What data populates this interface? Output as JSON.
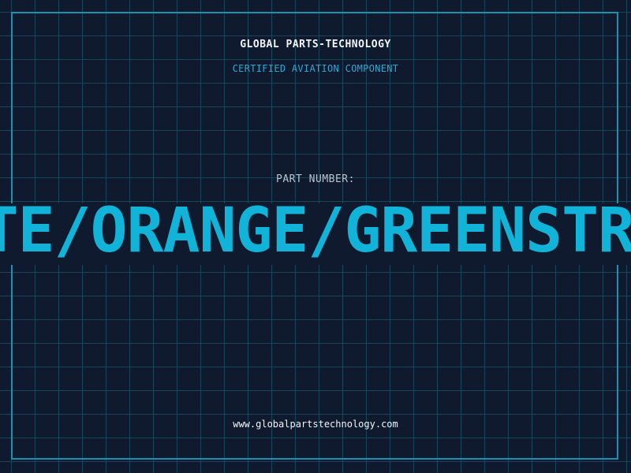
{
  "header": {
    "company": "GLOBAL PARTS-TECHNOLOGY",
    "subtitle": "CERTIFIED AVIATION COMPONENT"
  },
  "part": {
    "label": "PART NUMBER:",
    "number": "TE/ORANGE/GREENSTR"
  },
  "footer": {
    "website": "www.globalpartstechnology.com"
  },
  "colors": {
    "background": "#101a2e",
    "grid": "#17465a",
    "accent": "#11b3d8",
    "frame": "#1e8fb0"
  }
}
